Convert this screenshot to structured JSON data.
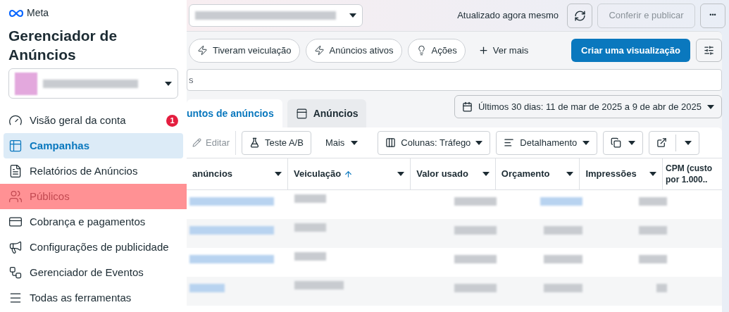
{
  "sidebar": {
    "logo": "Meta",
    "title": "Gerenciador de Anúncios",
    "items": [
      {
        "label": "Visão geral da conta",
        "badge": "1",
        "selected": false,
        "highlighted": false
      },
      {
        "label": "Campanhas",
        "selected": true,
        "highlighted": false
      },
      {
        "label": "Relatórios de Anúncios",
        "selected": false,
        "highlighted": false
      },
      {
        "label": "Públicos",
        "selected": false,
        "highlighted": true
      },
      {
        "label": "Cobrança e pagamentos",
        "selected": false,
        "highlighted": false
      },
      {
        "label": "Configurações de publicidade",
        "selected": false,
        "highlighted": false
      },
      {
        "label": "Gerenciador de Eventos",
        "selected": false,
        "highlighted": false
      },
      {
        "label": "Todas as ferramentas",
        "selected": false,
        "highlighted": false
      }
    ]
  },
  "top_bar": {
    "status": "Atualizado agora mesmo",
    "publish_button": {
      "label": "Conferir e publicar",
      "disabled": true
    },
    "more_button": "•••"
  },
  "filters": {
    "chips": [
      {
        "label": "Tiveram veiculação"
      },
      {
        "label": "Anúncios ativos"
      },
      {
        "label": "Ações"
      }
    ],
    "see_more": "Ver mais",
    "create_button": "Criar uma visualização"
  },
  "search": {
    "value": "s"
  },
  "tabs": [
    {
      "label": "untos de anúncios",
      "selected": true
    },
    {
      "label": "Anúncios",
      "selected": false
    }
  ],
  "date_range": "Últimos 30 dias: 11 de mar de 2025 a 9 de abr de 2025",
  "toolbar": {
    "edit": {
      "label": "Editar",
      "disabled": true
    },
    "ab_test": "Teste A/B",
    "more": "Mais",
    "columns": "Colunas: Tráfego",
    "breakdown": "Detalhamento"
  },
  "table": {
    "columns": [
      {
        "label": "anúncios",
        "sorted": false
      },
      {
        "label": "Veiculação",
        "sorted": true
      },
      {
        "label": "Valor usado",
        "sorted": false
      },
      {
        "label": "Orçamento",
        "sorted": false
      },
      {
        "label": "Impressões",
        "sorted": false
      },
      {
        "label": "CPM (custo por 1.000..",
        "sorted": false
      }
    ]
  }
}
